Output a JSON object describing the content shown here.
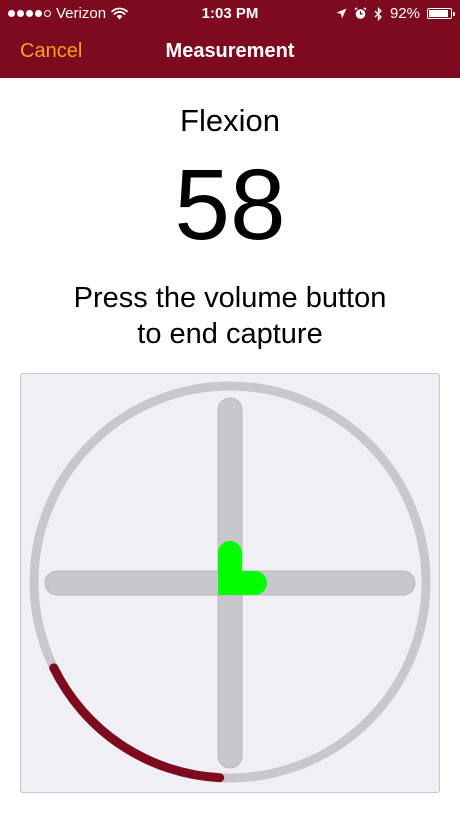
{
  "status_bar": {
    "signal_filled": 4,
    "signal_total": 5,
    "carrier": "Verizon",
    "time": "1:03 PM",
    "battery_percent": "92%",
    "battery_level": 0.92,
    "icons": [
      "wifi-icon",
      "location-arrow-icon",
      "alarm-icon",
      "bluetooth-icon",
      "battery-icon"
    ]
  },
  "nav": {
    "cancel_label": "Cancel",
    "title": "Measurement"
  },
  "measurement": {
    "label": "Flexion",
    "value": "58",
    "instructions_line1": "Press the volume button",
    "instructions_line2": "to end capture"
  },
  "gauge": {
    "arc_start_deg": 206,
    "arc_end_deg": 267,
    "colors": {
      "panel_bg": "#efeff4",
      "ring": "#c7c7cc",
      "crosshair": "#c7c7cc",
      "arc": "#7d0a1f",
      "indicator": "#00ff00"
    }
  },
  "colors": {
    "nav_bg": "#7d0a1f",
    "accent": "#f6a21b"
  }
}
